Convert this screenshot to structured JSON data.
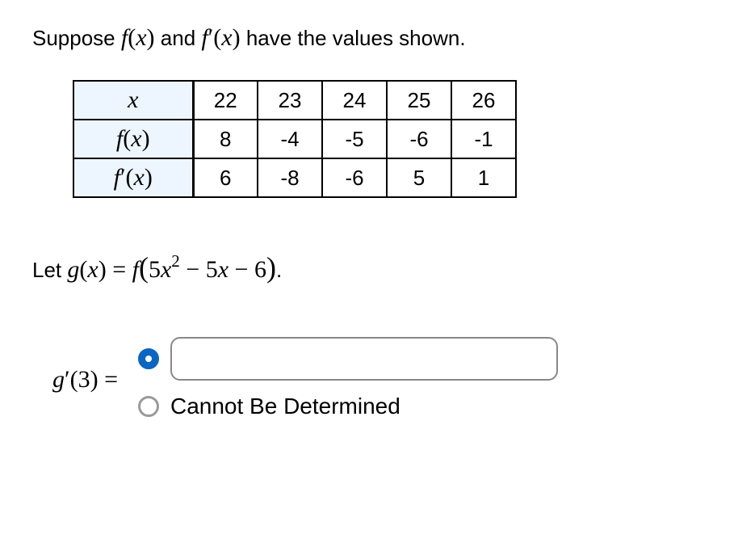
{
  "prompt": {
    "prefix": "Suppose ",
    "fx": "f(x)",
    "mid": " and ",
    "fprimex": "f′(x)",
    "suffix": " have the values shown."
  },
  "table": {
    "row_headers": [
      "x",
      "f(x)",
      "f′(x)"
    ],
    "columns": [
      "22",
      "23",
      "24",
      "25",
      "26"
    ],
    "rows": [
      [
        "8",
        "-4",
        "-5",
        "-6",
        "-1"
      ],
      [
        "6",
        "-8",
        "-6",
        "5",
        "1"
      ]
    ]
  },
  "chart_data": {
    "type": "table",
    "title": "Values of f(x) and f'(x)",
    "columns": [
      "x",
      "f(x)",
      "f'(x)"
    ],
    "data": [
      {
        "x": 22,
        "f": 8,
        "fprime": 6
      },
      {
        "x": 23,
        "f": -4,
        "fprime": -8
      },
      {
        "x": 24,
        "f": -5,
        "fprime": -6
      },
      {
        "x": 25,
        "f": -6,
        "fprime": 5
      },
      {
        "x": 26,
        "f": -1,
        "fprime": 1
      }
    ]
  },
  "let_line": {
    "prefix": "Let ",
    "gx": "g(x)",
    "equals": " = ",
    "expr_f": "f",
    "expr_open": "(",
    "expr_inner_5x2": "5x",
    "expr_inner_exp": "2",
    "expr_inner_minus5x": " − 5x − 6",
    "expr_close": ")",
    "period": "."
  },
  "answer": {
    "label_g": "g",
    "label_prime": "′",
    "label_open": "(",
    "label_arg": "3",
    "label_close": ")",
    "label_equals": " = ",
    "input_value": "",
    "cannot_label": "Cannot Be Determined"
  }
}
